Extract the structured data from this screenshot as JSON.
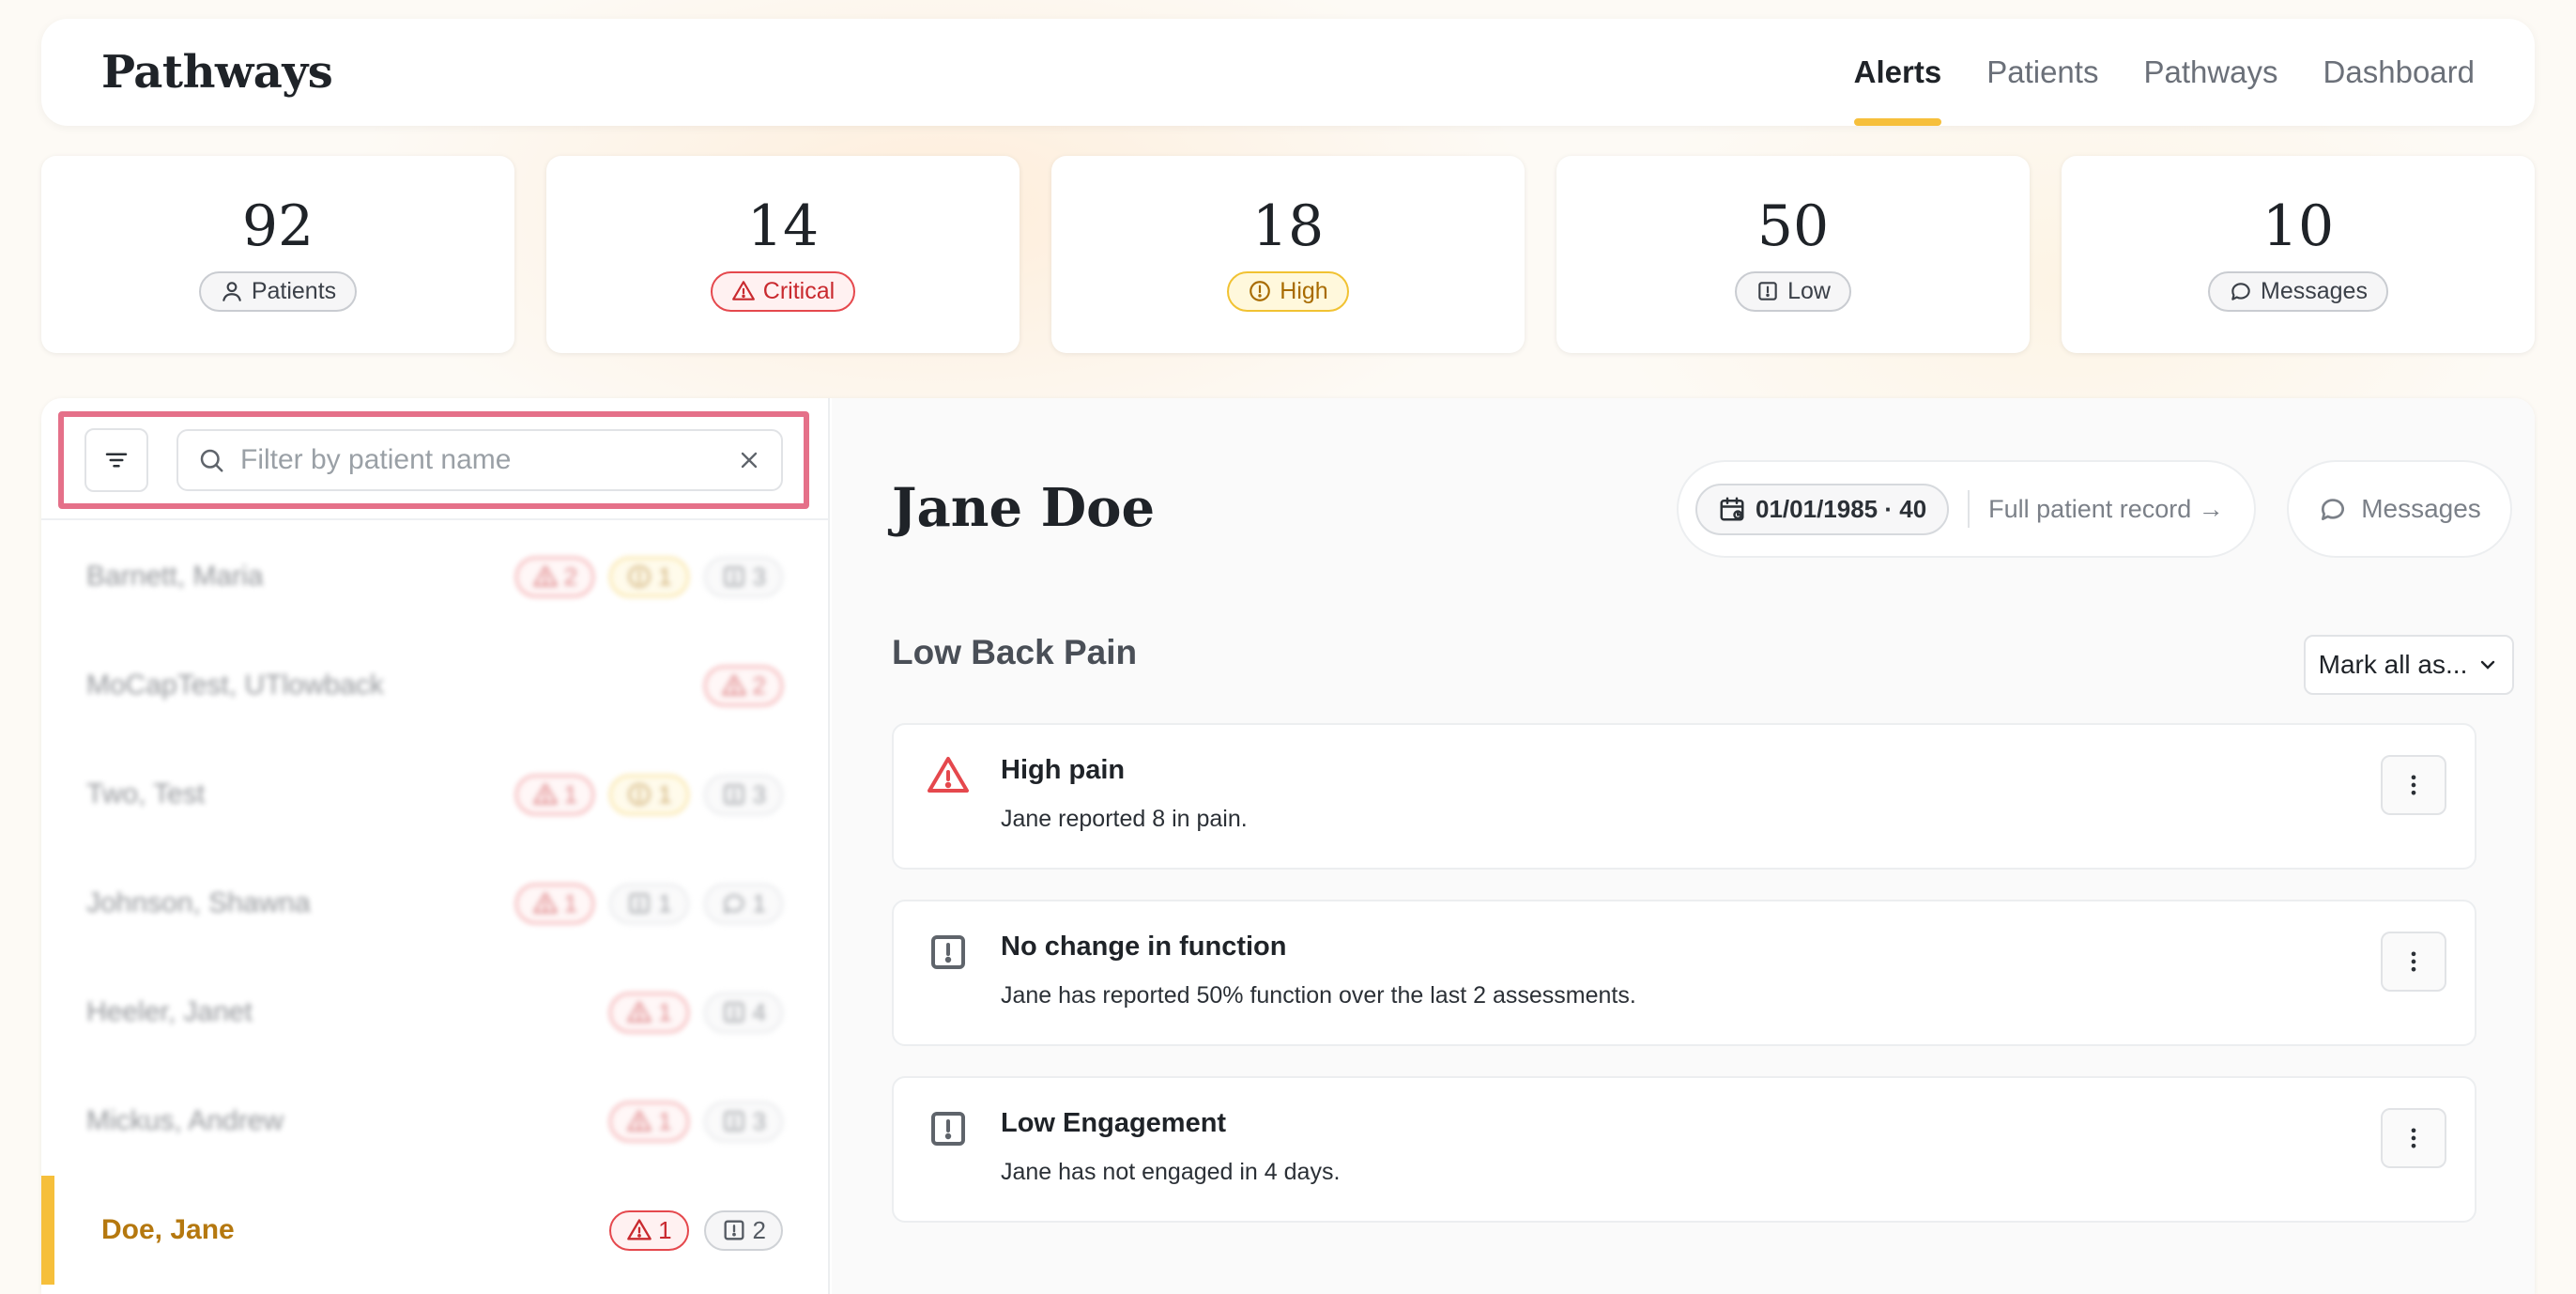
{
  "app": {
    "title": "Pathways"
  },
  "nav": {
    "tabs": [
      {
        "label": "Alerts",
        "active": true
      },
      {
        "label": "Patients",
        "active": false
      },
      {
        "label": "Pathways",
        "active": false
      },
      {
        "label": "Dashboard",
        "active": false
      }
    ]
  },
  "stats": [
    {
      "value": "92",
      "label": "Patients",
      "icon": "user-icon",
      "kind": "neutral"
    },
    {
      "value": "14",
      "label": "Critical",
      "icon": "warning-triangle-icon",
      "kind": "critical"
    },
    {
      "value": "18",
      "label": "High",
      "icon": "alert-circle-icon",
      "kind": "high"
    },
    {
      "value": "50",
      "label": "Low",
      "icon": "alert-square-icon",
      "kind": "low"
    },
    {
      "value": "10",
      "label": "Messages",
      "icon": "chat-bubble-icon",
      "kind": "neutral"
    }
  ],
  "sidebar": {
    "search_placeholder": "Filter by patient name",
    "search_value": "",
    "patients": [
      {
        "name": "Barnett, Maria",
        "blurred": true,
        "badges": [
          {
            "kind": "critical",
            "count": "2"
          },
          {
            "kind": "high",
            "count": "1"
          },
          {
            "kind": "low",
            "count": "3"
          }
        ]
      },
      {
        "name": "MoCapTest, UTlowback",
        "blurred": true,
        "badges": [
          {
            "kind": "critical",
            "count": "2"
          }
        ]
      },
      {
        "name": "Two, Test",
        "blurred": true,
        "badges": [
          {
            "kind": "critical",
            "count": "1"
          },
          {
            "kind": "high",
            "count": "1"
          },
          {
            "kind": "low",
            "count": "3"
          }
        ]
      },
      {
        "name": "Johnson, Shawna",
        "blurred": true,
        "badges": [
          {
            "kind": "critical",
            "count": "1"
          },
          {
            "kind": "low",
            "count": "1"
          },
          {
            "kind": "message",
            "count": "1"
          }
        ]
      },
      {
        "name": "Heeler, Janet",
        "blurred": true,
        "badges": [
          {
            "kind": "critical",
            "count": "1"
          },
          {
            "kind": "low",
            "count": "4"
          }
        ]
      },
      {
        "name": "Mickus, Andrew",
        "blurred": true,
        "badges": [
          {
            "kind": "critical",
            "count": "1"
          },
          {
            "kind": "low",
            "count": "3"
          }
        ]
      },
      {
        "name": "Doe, Jane",
        "blurred": false,
        "selected": true,
        "badges": [
          {
            "kind": "critical",
            "count": "1"
          },
          {
            "kind": "low",
            "count": "2"
          }
        ]
      }
    ]
  },
  "detail": {
    "patient_name": "Jane Doe",
    "dob": "01/01/1985 · 40",
    "full_record_label": "Full patient record →",
    "messages_label": "Messages",
    "section_title": "Low Back Pain",
    "mark_all_label": "Mark all as...",
    "alerts": [
      {
        "kind": "critical",
        "title": "High pain",
        "description": "Jane reported 8 in pain."
      },
      {
        "kind": "low",
        "title": "No change in function",
        "description": "Jane has reported 50% function over the last 2 assessments."
      },
      {
        "kind": "low",
        "title": "Low Engagement",
        "description": "Jane has not engaged in 4 days."
      }
    ]
  },
  "colors": {
    "accent": "#f6bf3b",
    "critical": "#e5484d",
    "high": "#f1c232",
    "highlight": "#e57089"
  }
}
